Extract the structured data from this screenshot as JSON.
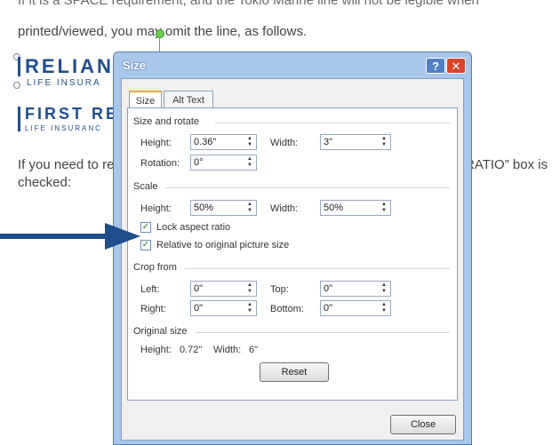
{
  "document": {
    "line1": "If it is a SPACE requirement, and the Tokio Marine line will not be legible when",
    "line2": "printed/viewed, you may omit the line, as follows.",
    "line3": "If you need to re",
    "line3_right": "RATIO” box is",
    "line4": "checked:",
    "logo1": "RELIAN",
    "logo1_sub": "LIFE INSURA",
    "logo2": "FIRST REL",
    "logo2_sub": "LIFE INSURANC"
  },
  "dialog": {
    "title": "Size",
    "help": "?",
    "close_x": "✕",
    "tabs": {
      "size": "Size",
      "alt_text": "Alt Text"
    },
    "size_rotate": {
      "heading": "Size and rotate",
      "height_label": "Height:",
      "height_value": "0.36\"",
      "width_label": "Width:",
      "width_value": "3\"",
      "rotation_label": "Rotation:",
      "rotation_value": "0°"
    },
    "scale": {
      "heading": "Scale",
      "height_label": "Height:",
      "height_value": "50%",
      "width_label": "Width:",
      "width_value": "50%",
      "lock_aspect": "Lock aspect ratio",
      "lock_aspect_checked": true,
      "relative": "Relative to original picture size",
      "relative_checked": true
    },
    "crop": {
      "heading": "Crop from",
      "left_label": "Left:",
      "left_value": "0\"",
      "top_label": "Top:",
      "top_value": "0\"",
      "right_label": "Right:",
      "right_value": "0\"",
      "bottom_label": "Bottom:",
      "bottom_value": "0\""
    },
    "original": {
      "heading": "Original size",
      "height_label": "Height:",
      "height_value": "0.72\"",
      "width_label": "Width:",
      "width_value": "6\""
    },
    "reset": "Reset",
    "close": "Close"
  },
  "colors": {
    "accent": "#1f4e8c",
    "arrow": "#1f4e8c",
    "dialog_frame": "#a9c6eb"
  }
}
